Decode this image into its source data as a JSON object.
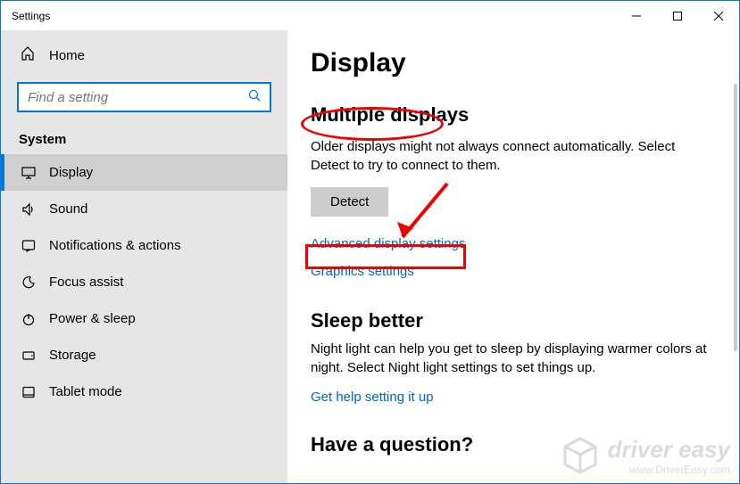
{
  "titlebar": {
    "title": "Settings"
  },
  "sidebar": {
    "home_label": "Home",
    "search_placeholder": "Find a setting",
    "section_label": "System",
    "items": [
      {
        "label": "Display"
      },
      {
        "label": "Sound"
      },
      {
        "label": "Notifications & actions"
      },
      {
        "label": "Focus assist"
      },
      {
        "label": "Power & sleep"
      },
      {
        "label": "Storage"
      },
      {
        "label": "Tablet mode"
      }
    ]
  },
  "main": {
    "page_title": "Display",
    "multi_title": "Multiple displays",
    "multi_desc": "Older displays might not always connect automatically. Select Detect to try to connect to them.",
    "detect_label": "Detect",
    "adv_link": "Advanced display settings",
    "graphics_link": "Graphics settings",
    "sleep_title": "Sleep better",
    "sleep_desc": "Night light can help you get to sleep by displaying warmer colors at night. Select Night light settings to set things up.",
    "sleep_link": "Get help setting it up",
    "question_title": "Have a question?"
  },
  "watermark": {
    "brand": "driver easy",
    "url": "www.DriverEasy.com"
  }
}
